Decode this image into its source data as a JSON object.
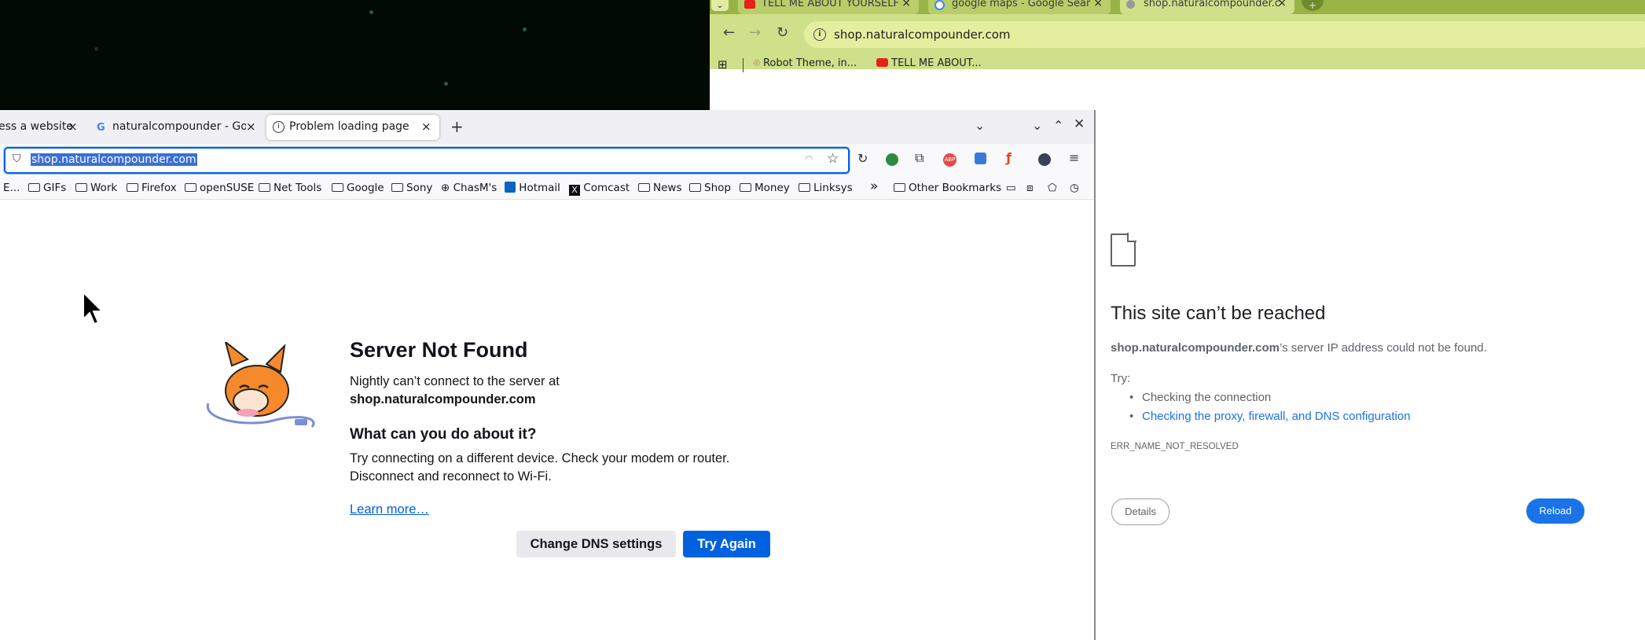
{
  "chrome": {
    "tabs": [
      {
        "label": "TELL ME ABOUT YOURSELF",
        "close": "×"
      },
      {
        "label": "google maps - Google Sear",
        "close": "×"
      },
      {
        "label": "shop.naturalcompounder.c",
        "close": "×"
      }
    ],
    "url": "shop.naturalcompounder.com",
    "bookmarks": [
      "Robot Theme, in...",
      "TELL ME ABOUT..."
    ],
    "error": {
      "title": "This site can’t be reached",
      "host": "shop.naturalcompounder.com",
      "message_suffix": "’s server IP address could not be found.",
      "try_label": "Try:",
      "suggestions": [
        "Checking the connection",
        "Checking the proxy, firewall, and DNS configuration"
      ],
      "code": "ERR_NAME_NOT_RESOLVED",
      "details_button": "Details",
      "reload_button": "Reload"
    }
  },
  "firefox": {
    "tabs": [
      {
        "label": "ess a website",
        "close": "×"
      },
      {
        "label": "naturalcompounder - Goo",
        "close": "×"
      },
      {
        "label": "Problem loading page",
        "close": "×"
      }
    ],
    "new_tab": "+",
    "url": "shop.naturalcompounder.com",
    "bookmarks": [
      "E...",
      "GIFs",
      "Work",
      "Firefox",
      "openSUSE",
      "Net Tools",
      "Google",
      "Sony",
      "ChasM's",
      "Hotmail",
      "Comcast",
      "News",
      "Shop",
      "Money",
      "Linksys",
      "Other Bookmarks"
    ],
    "overflow": "»",
    "page": {
      "title": "Server Not Found",
      "line1": "Nightly can’t connect to the server at",
      "host": "shop.naturalcompounder.com",
      "subtitle": "What can you do about it?",
      "advice1": "Try connecting on a different device. Check your modem or router.",
      "advice2": "Disconnect and reconnect to Wi-Fi.",
      "learn_more": "Learn more…",
      "dns_button": "Change DNS settings",
      "try_again_button": "Try Again"
    }
  },
  "colors": {
    "chrome_frame": "#99b446",
    "chrome_toolbar": "#cfe08a",
    "accent_blue": "#0061e0",
    "chrome_blue": "#1a73e8"
  }
}
